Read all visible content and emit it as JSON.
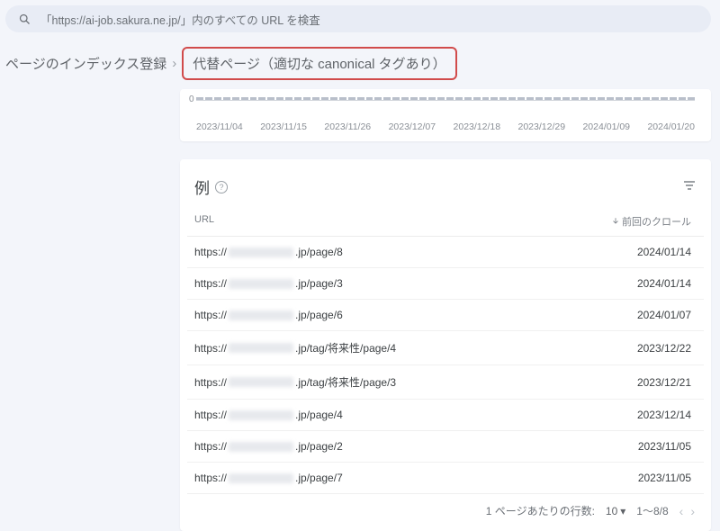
{
  "search": {
    "placeholder": "「https://ai-job.sakura.ne.jp/」内のすべての URL を検査"
  },
  "breadcrumb": {
    "root": "ページのインデックス登録",
    "current": "代替ページ（適切な canonical タグあり）"
  },
  "chart_data": {
    "type": "bar",
    "zero_label": "0",
    "categories": [
      "2023/11/04",
      "2023/11/15",
      "2023/11/26",
      "2023/12/07",
      "2023/12/18",
      "2023/12/29",
      "2024/01/09",
      "2024/01/20"
    ]
  },
  "examples": {
    "title": "例",
    "columns": {
      "url": "URL",
      "crawl": "前回のクロール"
    },
    "rows": [
      {
        "pre": "https://",
        "suf": ".jp/page/8",
        "date": "2024/01/14"
      },
      {
        "pre": "https://",
        "suf": ".jp/page/3",
        "date": "2024/01/14"
      },
      {
        "pre": "https://",
        "suf": ".jp/page/6",
        "date": "2024/01/07"
      },
      {
        "pre": "https://",
        "suf": ".jp/tag/将来性/page/4",
        "date": "2023/12/22"
      },
      {
        "pre": "https://",
        "suf": ".jp/tag/将来性/page/3",
        "date": "2023/12/21"
      },
      {
        "pre": "https://",
        "suf": ".jp/page/4",
        "date": "2023/12/14"
      },
      {
        "pre": "https://",
        "suf": ".jp/page/2",
        "date": "2023/11/05"
      },
      {
        "pre": "https://",
        "suf": ".jp/page/7",
        "date": "2023/11/05"
      }
    ],
    "pager": {
      "rows_label": "1 ページあたりの行数:",
      "rows_value": "10",
      "range": "1～8/8"
    }
  }
}
